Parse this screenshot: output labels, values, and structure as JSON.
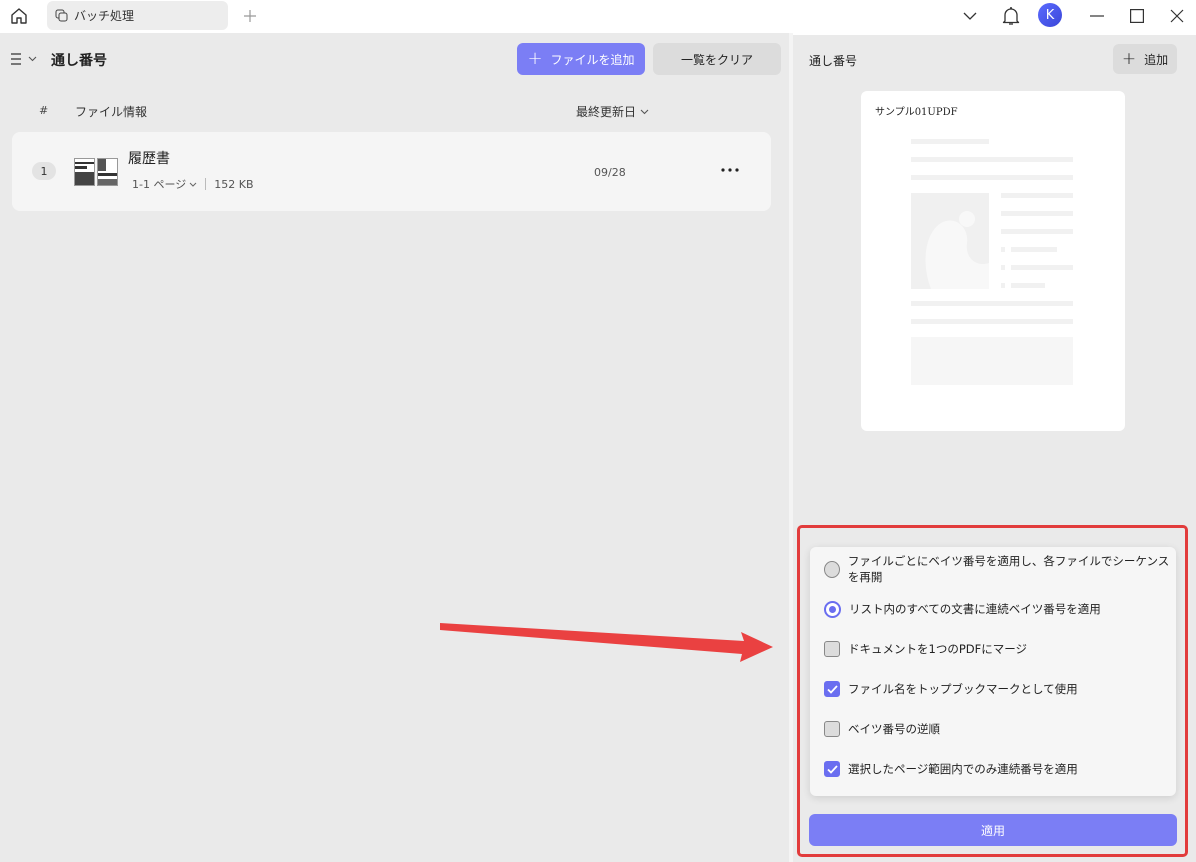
{
  "titlebar": {
    "home_icon": "home-icon",
    "tab_label": "バッチ処理",
    "tab_icon": "batch-icon",
    "new_tab_icon": "plus-icon",
    "avatar_initial": "K"
  },
  "left": {
    "title": "通し番号",
    "add_file_label": "ファイルを追加",
    "clear_label": "一覧をクリア",
    "col_num": "#",
    "col_info": "ファイル情報",
    "col_date": "最終更新日",
    "files": [
      {
        "index": "1",
        "name": "履歴書",
        "pages": "1-1 ページ",
        "size": "152 KB",
        "date": "09/28"
      }
    ]
  },
  "right": {
    "title": "通し番号",
    "add_label": "追加",
    "preview_title": "サンプル01UPDF",
    "options": [
      {
        "type": "radio",
        "checked": false,
        "label": "ファイルごとにベイツ番号を適用し、各ファイルでシーケンスを再開"
      },
      {
        "type": "radio",
        "checked": true,
        "label": "リスト内のすべての文書に連続ベイツ番号を適用"
      },
      {
        "type": "checkbox",
        "checked": false,
        "label": "ドキュメントを1つのPDFにマージ"
      },
      {
        "type": "checkbox",
        "checked": true,
        "label": "ファイル名をトップブックマークとして使用"
      },
      {
        "type": "checkbox",
        "checked": false,
        "label": "ベイツ番号の逆順"
      },
      {
        "type": "checkbox",
        "checked": true,
        "label": "選択したページ範囲内でのみ連続番号を適用"
      }
    ],
    "apply_label": "適用"
  },
  "colors": {
    "accent": "#7b7ef5",
    "highlight": "#e23c3c",
    "arrow": "#ea4141"
  }
}
